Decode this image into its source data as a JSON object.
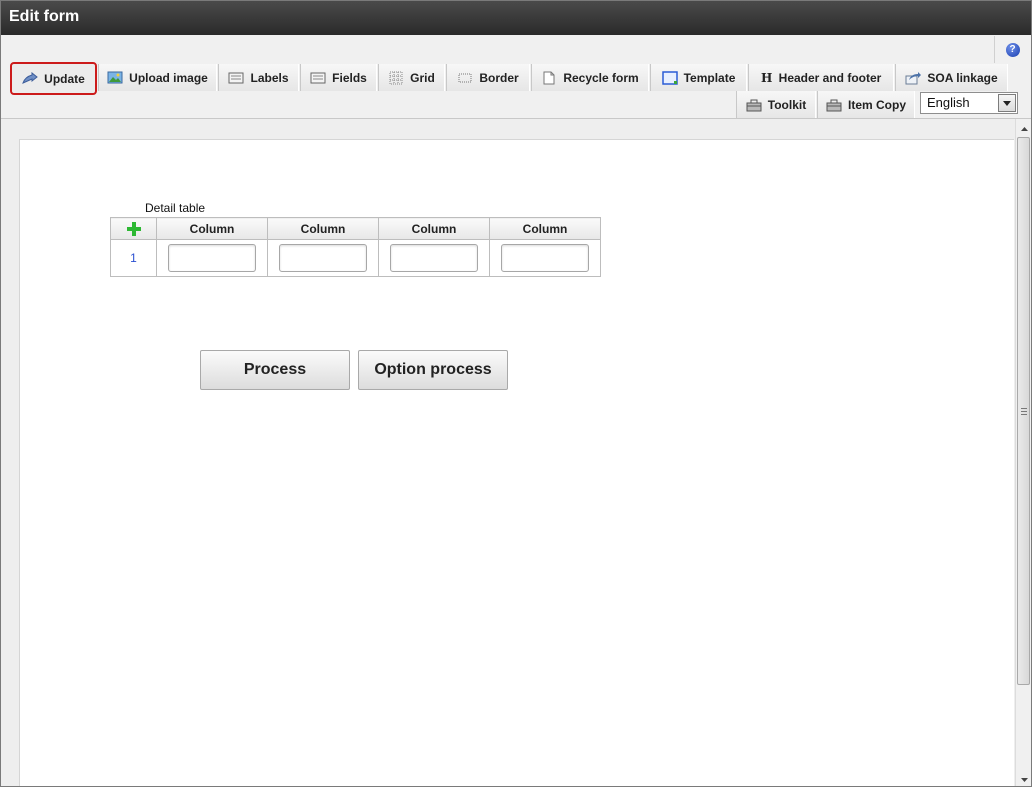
{
  "window": {
    "title": "Edit form"
  },
  "toolbar": {
    "row1": [
      {
        "id": "update",
        "label": "Update",
        "icon": "update-icon"
      },
      {
        "id": "upload-image",
        "label": "Upload image",
        "icon": "image-icon"
      },
      {
        "id": "labels",
        "label": "Labels",
        "icon": "labels-icon"
      },
      {
        "id": "fields",
        "label": "Fields",
        "icon": "fields-icon"
      },
      {
        "id": "grid",
        "label": "Grid",
        "icon": "grid-icon"
      },
      {
        "id": "border",
        "label": "Border",
        "icon": "border-icon"
      },
      {
        "id": "recycle-form",
        "label": "Recycle form",
        "icon": "document-icon"
      },
      {
        "id": "template",
        "label": "Template",
        "icon": "template-icon"
      },
      {
        "id": "header-footer",
        "label": "Header and footer",
        "icon": "header-icon"
      },
      {
        "id": "soa-linkage",
        "label": "SOA linkage",
        "icon": "share-icon"
      }
    ],
    "row2": [
      {
        "id": "toolkit",
        "label": "Toolkit",
        "icon": "toolbox-icon"
      },
      {
        "id": "item-copy",
        "label": "Item Copy",
        "icon": "toolbox-icon"
      }
    ],
    "language": {
      "selected": "English"
    },
    "help_icon": "help-icon",
    "header_glyph": "H"
  },
  "form": {
    "detail_table": {
      "title": "Detail table",
      "columns": [
        "Column",
        "Column",
        "Column",
        "Column"
      ],
      "rows": [
        {
          "index": "1",
          "values": [
            "",
            "",
            "",
            ""
          ]
        }
      ]
    },
    "buttons": {
      "process": "Process",
      "option_process": "Option process"
    }
  },
  "colors": {
    "highlight": "#cc1b1b",
    "titlebar": "#2f2f2f",
    "add_icon": "#2db833",
    "link": "#2a4fd1"
  }
}
